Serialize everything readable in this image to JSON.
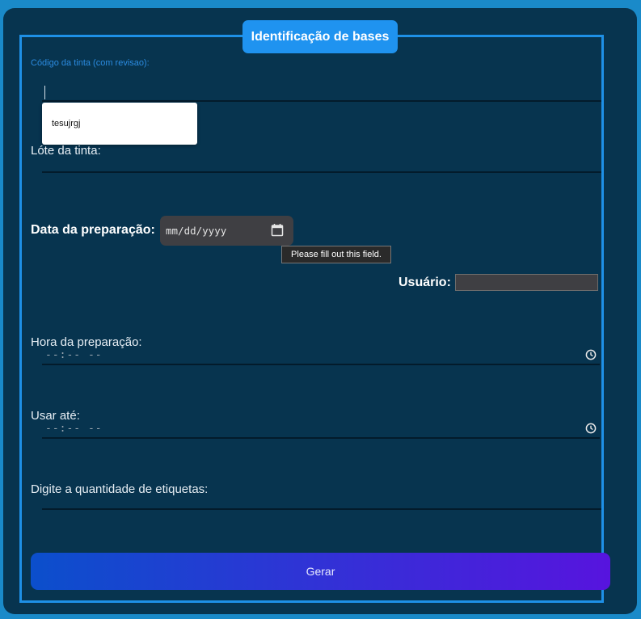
{
  "form": {
    "legend": "Identificação de bases",
    "codigo": {
      "label": "Código da tinta (com revisao):",
      "value": ""
    },
    "autocomplete": {
      "suggestion": "tesujrgj"
    },
    "lote": {
      "label": "Lóte da tinta:",
      "value": ""
    },
    "data": {
      "label": "Data da preparação:",
      "placeholder": "mm/dd/yyyy",
      "icon": "calendar-icon"
    },
    "tooltip": "Please fill out this field.",
    "usuario": {
      "label": "Usuário:",
      "value": ""
    },
    "hora": {
      "label": "Hora da preparação:",
      "placeholder": "--:-- --",
      "icon": "clock-icon"
    },
    "usar_ate": {
      "label": "Usar até:",
      "placeholder": "--:-- --",
      "icon": "clock-icon"
    },
    "quantidade": {
      "label": "Digite a quantidade de etiquetas:",
      "value": ""
    },
    "submit_label": "Gerar"
  },
  "colors": {
    "page_bg": "#1a8ac9",
    "card_bg": "#07344f",
    "accent": "#1f93f0",
    "button_gradient_start": "#0b4fcc",
    "button_gradient_end": "#5714de"
  }
}
